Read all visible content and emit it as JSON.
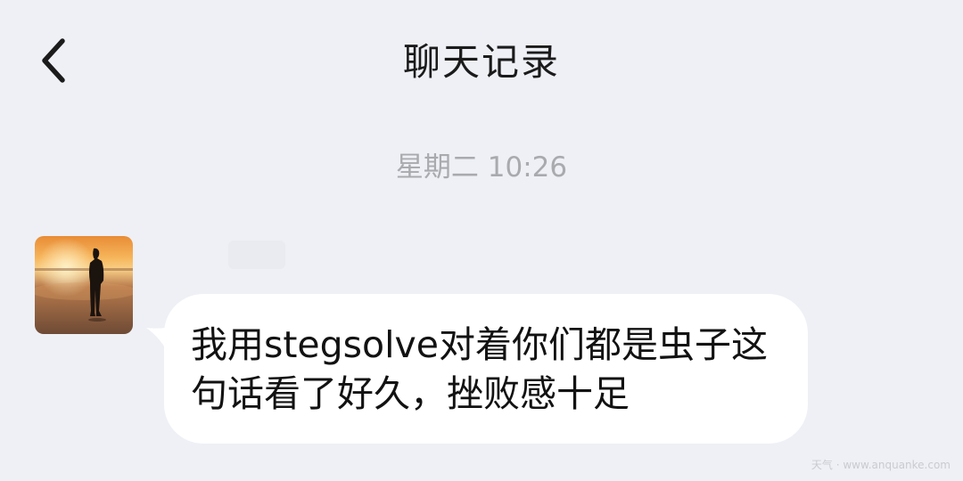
{
  "header": {
    "title": "聊天记录",
    "back_icon": "chevron-left-icon"
  },
  "chat": {
    "timestamp": "星期二 10:26",
    "messages": [
      {
        "sender_avatar": "sunset-silhouette-avatar",
        "text": "我用stegsolve对着你们都是虫子这句话看了好久，挫败感十足"
      }
    ]
  },
  "watermark": "天气 · www.anquanke.com"
}
